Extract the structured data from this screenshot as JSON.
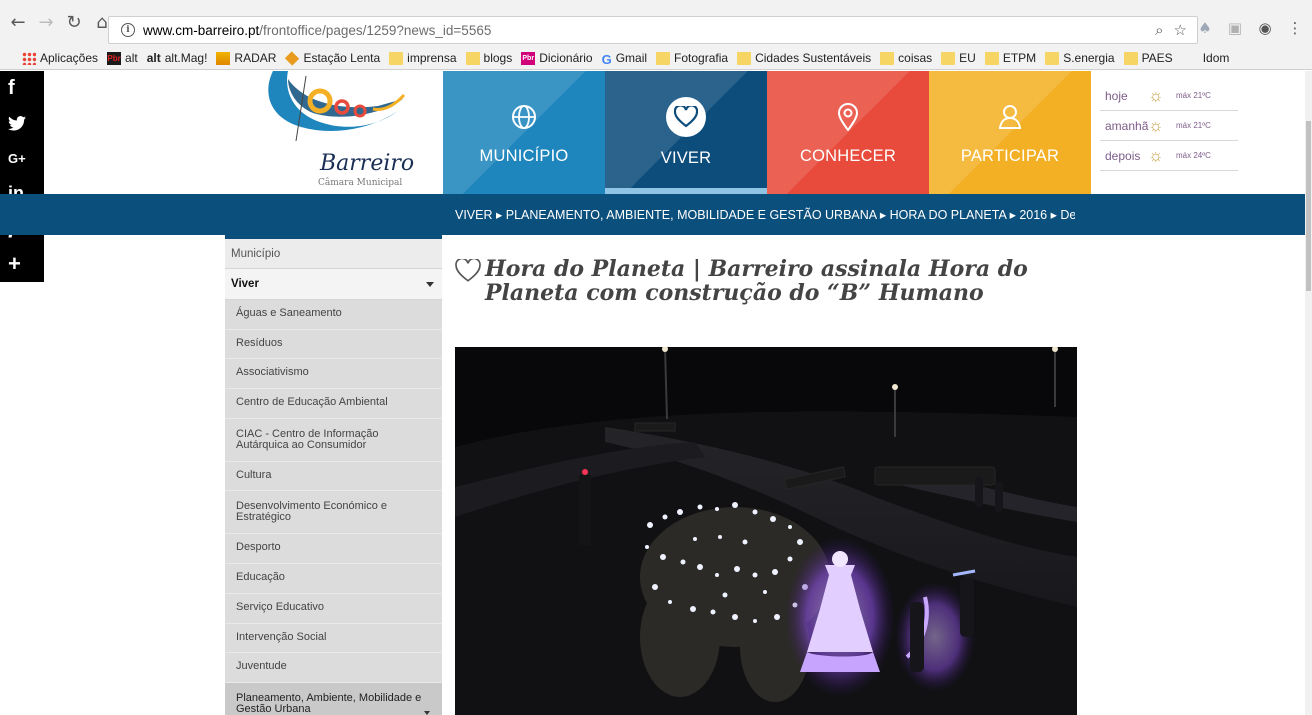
{
  "browser": {
    "url_host": "www.cm-barreiro.pt",
    "url_path": "/frontoffice/pages/1259?news_id=5565",
    "bookmarks": [
      {
        "label": "Aplicações",
        "icon": "apps-grid-icon"
      },
      {
        "label": "alt",
        "icon": "alt-logo-icon"
      },
      {
        "label": "alt.Mag!",
        "icon": "alt-mag-icon"
      },
      {
        "label": "RADAR",
        "icon": "radar-icon"
      },
      {
        "label": "Estação Lenta",
        "icon": "estacao-lenta-icon"
      },
      {
        "label": "imprensa",
        "icon": "folder-icon"
      },
      {
        "label": "blogs",
        "icon": "folder-icon"
      },
      {
        "label": "Dicionário",
        "icon": "dicionario-icon"
      },
      {
        "label": "Gmail",
        "icon": "google-g-icon"
      },
      {
        "label": "Fotografia",
        "icon": "folder-icon"
      },
      {
        "label": "Cidades Sustentáveis",
        "icon": "folder-icon"
      },
      {
        "label": "coisas",
        "icon": "folder-icon"
      },
      {
        "label": "EU",
        "icon": "folder-icon"
      },
      {
        "label": "ETPM",
        "icon": "folder-icon"
      },
      {
        "label": "S.energia",
        "icon": "folder-icon"
      },
      {
        "label": "PAES",
        "icon": "folder-icon"
      },
      {
        "label": "Idom",
        "icon": "none"
      }
    ],
    "alt_badge": "alt",
    "alt_mag_prefix": "alt",
    "dic_badge": "Pbr"
  },
  "social": [
    "f",
    "t",
    "G+",
    "in",
    "p",
    "+"
  ],
  "logo": {
    "word": "Barreiro",
    "sub": "Câmara Municipal"
  },
  "nav_tiles": [
    {
      "label": "MUNICÍPIO",
      "icon": "globe-icon",
      "color": "#1f86bd"
    },
    {
      "label": "VIVER",
      "icon": "heart-icon",
      "color": "#0d4d7c"
    },
    {
      "label": "CONHECER",
      "icon": "map-pin-icon",
      "color": "#e84b3c"
    },
    {
      "label": "PARTICIPAR",
      "icon": "person-icon",
      "color": "#f4b025"
    }
  ],
  "weather": [
    {
      "day": "hoje",
      "temp": "máx 21ºC"
    },
    {
      "day": "amanhã",
      "temp": "máx 21ºC"
    },
    {
      "day": "depois",
      "temp": "máx 24ºC"
    }
  ],
  "breadcrumb": "VIVER ▸ PLANEAMENTO, AMBIENTE, MOBILIDADE E GESTÃO URBANA ▸ HORA DO PLANETA ▸ 2016 ▸ De",
  "sidebar": {
    "top": "Município",
    "head": "Viver",
    "items": [
      "Águas e Saneamento",
      "Resíduos",
      "Associativismo",
      "Centro de Educação Ambiental",
      "CIAC - Centro de Informação Autárquica ao Consumidor",
      "Cultura",
      "Desenvolvimento Económico e Estratégico",
      "Desporto",
      "Educação",
      "Serviço Educativo",
      "Intervenção Social",
      "Juventude",
      "Planeamento, Ambiente, Mobilidade e Gestão Urbana"
    ]
  },
  "article": {
    "title": "Hora do Planeta | Barreiro assinala Hora do Planeta com construção do “B” Humano"
  }
}
